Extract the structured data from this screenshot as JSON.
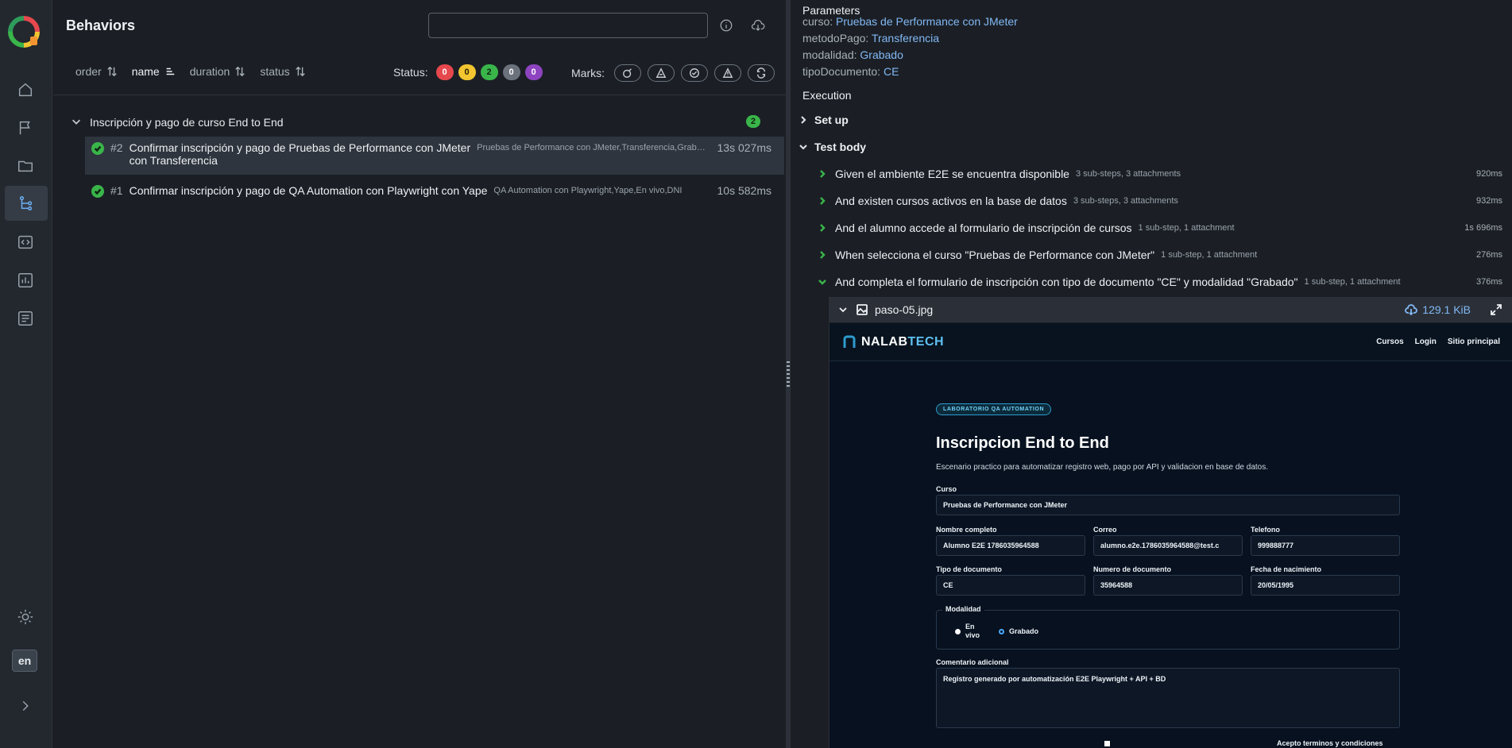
{
  "app": {
    "page_title": "Behaviors",
    "language": "en",
    "search_value": ""
  },
  "sort": {
    "order": "order",
    "name": "name",
    "duration": "duration",
    "status": "status"
  },
  "status_filter": {
    "label": "Status:",
    "counts": [
      {
        "value": "0",
        "bg": "#e5484d",
        "fg": "#ffffff"
      },
      {
        "value": "0",
        "bg": "#f2c531",
        "fg": "#2a2300"
      },
      {
        "value": "2",
        "bg": "#3ab54a",
        "fg": "#0e2410"
      },
      {
        "value": "0",
        "bg": "#6b727c",
        "fg": "#ffffff"
      },
      {
        "value": "0",
        "bg": "#8e44c0",
        "fg": "#ffffff"
      }
    ]
  },
  "marks": {
    "label": "Marks:"
  },
  "tree": {
    "group": {
      "title": "Inscripción y pago de curso End to End",
      "count": "2"
    },
    "rows": [
      {
        "num": "#2",
        "name_line1": "Confirmar inscripción y pago de Pruebas de Performance con JMeter",
        "name_line2": "con Transferencia",
        "params": "Pruebas de Performance con JMeter,Transferencia,Grabado,CE",
        "duration": "13s 027ms"
      },
      {
        "num": "#1",
        "name_line1": "Confirmar inscripción y pago de QA Automation con Playwright con Yape",
        "params": "QA Automation con Playwright,Yape,En vivo,DNI",
        "duration": "10s 582ms"
      }
    ]
  },
  "details": {
    "parameters_title": "Parameters",
    "parameters": [
      {
        "key": "curso",
        "value": "Pruebas de Performance con JMeter"
      },
      {
        "key": "metodoPago",
        "value": "Transferencia"
      },
      {
        "key": "modalidad",
        "value": "Grabado"
      },
      {
        "key": "tipoDocumento",
        "value": "CE"
      }
    ],
    "execution_title": "Execution",
    "setup_title": "Set up",
    "testbody_title": "Test body",
    "steps": [
      {
        "name": "Given el ambiente E2E se encuentra disponible",
        "meta": "3 sub-steps, 3 attachments",
        "duration": "920ms"
      },
      {
        "name": "And existen cursos activos en la base de datos",
        "meta": "3 sub-steps, 3 attachments",
        "duration": "932ms"
      },
      {
        "name": "And el alumno accede al formulario de inscripción de cursos",
        "meta": "1 sub-step, 1 attachment",
        "duration": "1s 696ms"
      },
      {
        "name": "When selecciona el curso \"Pruebas de Performance con JMeter\"",
        "meta": "1 sub-step, 1 attachment",
        "duration": "276ms"
      },
      {
        "name": "And completa el formulario de inscripción con tipo de documento \"CE\" y modalidad \"Grabado\"",
        "meta": "1 sub-step, 1 attachment",
        "duration": "376ms"
      }
    ],
    "attachment": {
      "name": "paso-05.jpg",
      "size": "129.1 KiB"
    }
  },
  "screenshot": {
    "brand_a": "NALAB",
    "brand_b": "TECH",
    "links": [
      "Cursos",
      "Login",
      "Sitio principal"
    ],
    "badge": "LABORATORIO QA AUTOMATION",
    "heading": "Inscripcion End to End",
    "subtitle": "Escenario practico para automatizar registro web, pago por API y validacion en base de datos.",
    "curso_label": "Curso",
    "curso_value": "Pruebas de Performance con JMeter",
    "nombre_label": "Nombre completo",
    "nombre_value": "Alumno E2E 1786035964588",
    "correo_label": "Correo",
    "correo_value": "alumno.e2e.1786035964588@test.c",
    "telefono_label": "Telefono",
    "telefono_value": "999888777",
    "tipo_label": "Tipo de documento",
    "tipo_value": "CE",
    "numdoc_label": "Numero de documento",
    "numdoc_value": "35964588",
    "fecha_label": "Fecha de nacimiento",
    "fecha_value": "20/05/1995",
    "modalidad_label": "Modalidad",
    "radio_a_1": "En",
    "radio_a_2": "vivo",
    "radio_b": "Grabado",
    "comentario_label": "Comentario adicional",
    "comentario_value": "Registro generado por automatización E2E Playwright + API + BD",
    "terms": "Acepto terminos y condiciones"
  }
}
